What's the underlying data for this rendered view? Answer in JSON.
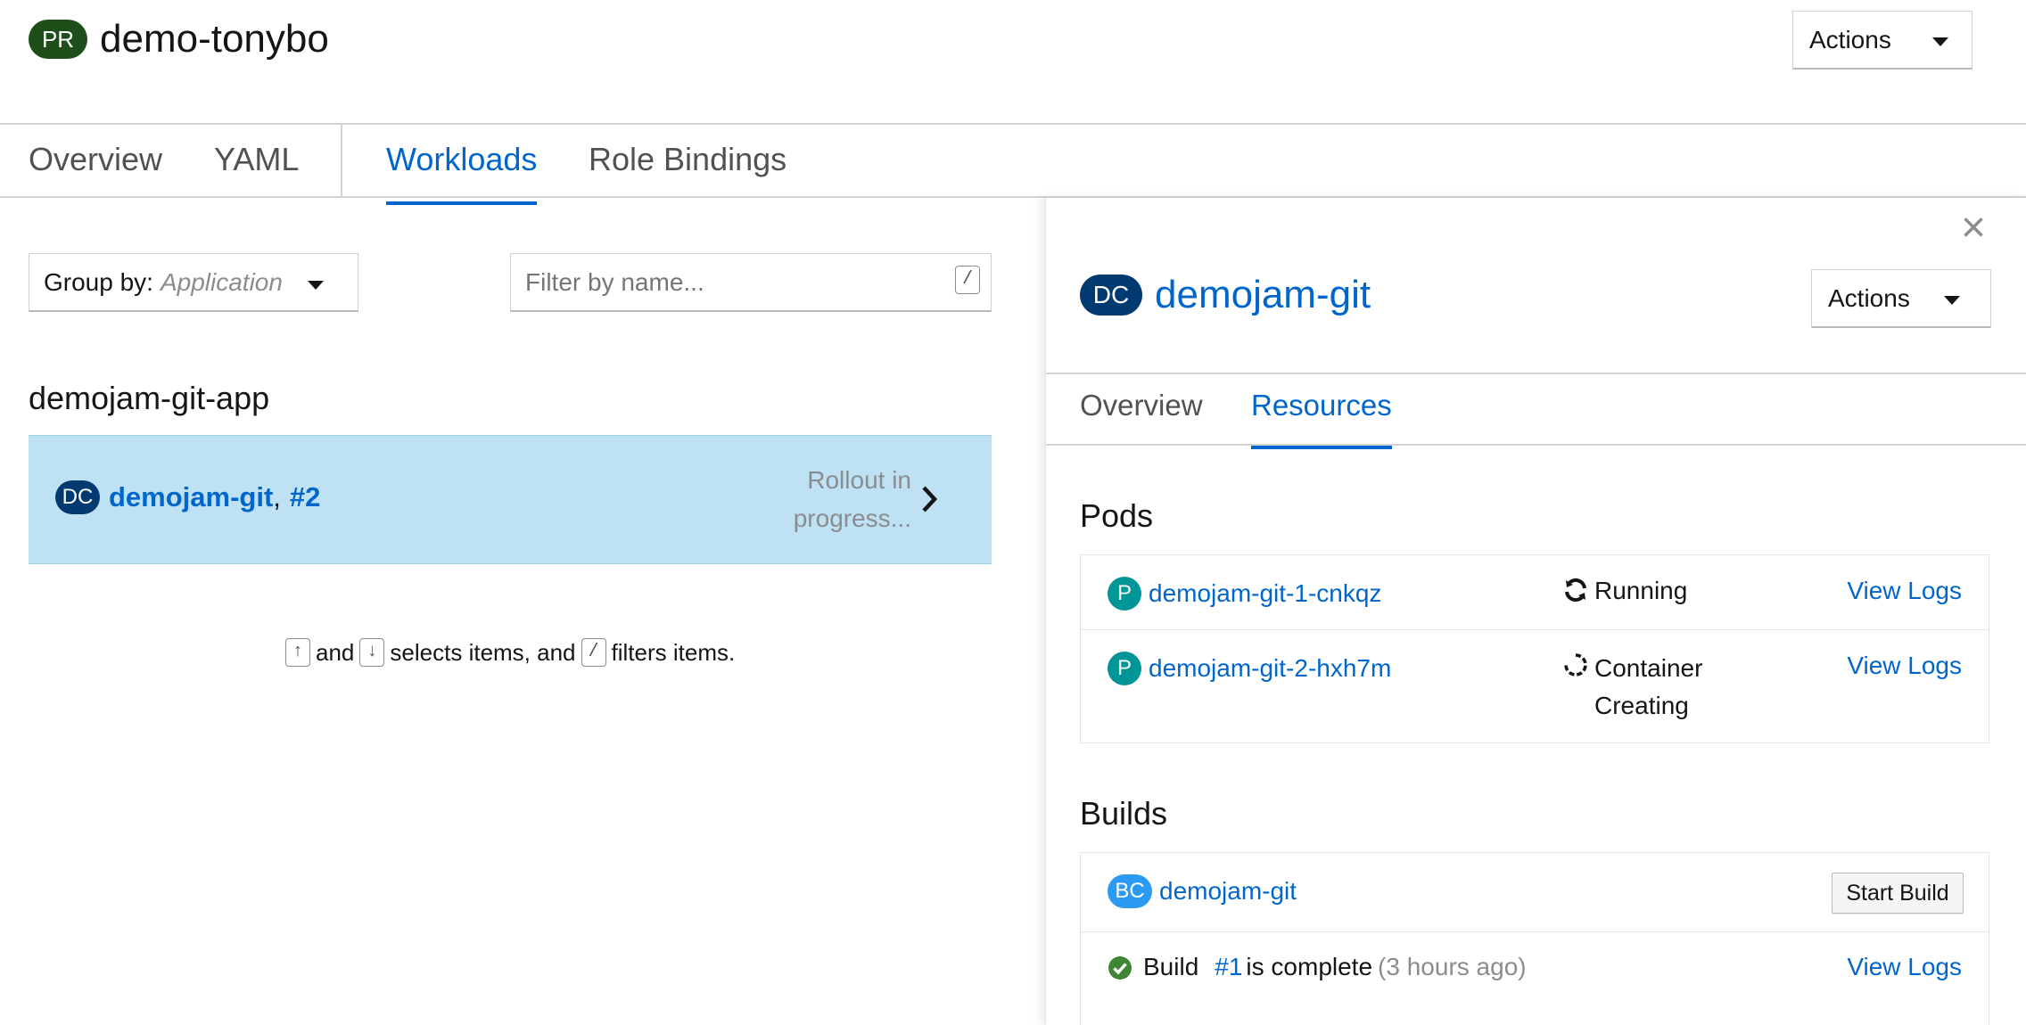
{
  "header": {
    "badge": "PR",
    "title": "demo-tonybo",
    "actions_label": "Actions"
  },
  "tabs": [
    {
      "label": "Overview"
    },
    {
      "label": "YAML"
    },
    {
      "label": "Workloads"
    },
    {
      "label": "Role Bindings"
    }
  ],
  "toolbar": {
    "group_by_label": "Group by:",
    "group_by_value": "Application",
    "filter_placeholder": "Filter by name...",
    "filter_shortcut": "/"
  },
  "group": {
    "title": "demojam-git-app",
    "item": {
      "badge": "DC",
      "name": "demojam-git",
      "separator": ",",
      "revision": "#2",
      "status": "Rollout in progress..."
    }
  },
  "hint": {
    "up_key": "↑",
    "and1": "and",
    "down_key": "↓",
    "selects": "selects items, and",
    "slash_key": "/",
    "filters": "filters items."
  },
  "panel": {
    "close": "×",
    "badge": "DC",
    "title": "demojam-git",
    "actions_label": "Actions",
    "tabs": [
      {
        "label": "Overview"
      },
      {
        "label": "Resources"
      }
    ],
    "pods": {
      "heading": "Pods",
      "items": [
        {
          "badge": "P",
          "name": "demojam-git-1-cnkqz",
          "status": "Running",
          "logs": "View Logs"
        },
        {
          "badge": "P",
          "name": "demojam-git-2-hxh7m",
          "status_line1": "Container",
          "status_line2": "Creating",
          "logs": "View Logs"
        }
      ]
    },
    "builds": {
      "heading": "Builds",
      "config": {
        "badge": "BC",
        "name": "demojam-git",
        "start_label": "Start Build"
      },
      "build": {
        "prefix": "Build",
        "number": "#1",
        "state": "is complete",
        "age": "(3 hours ago)",
        "logs": "View Logs"
      }
    }
  },
  "colors": {
    "accent": "#0066cc",
    "pr_badge": "#1e4f18",
    "dc_badge": "#003a70",
    "pod_badge": "#009596",
    "bc_badge": "#2b9af3",
    "selected_row": "#bee1f4",
    "success": "#3e8635"
  }
}
